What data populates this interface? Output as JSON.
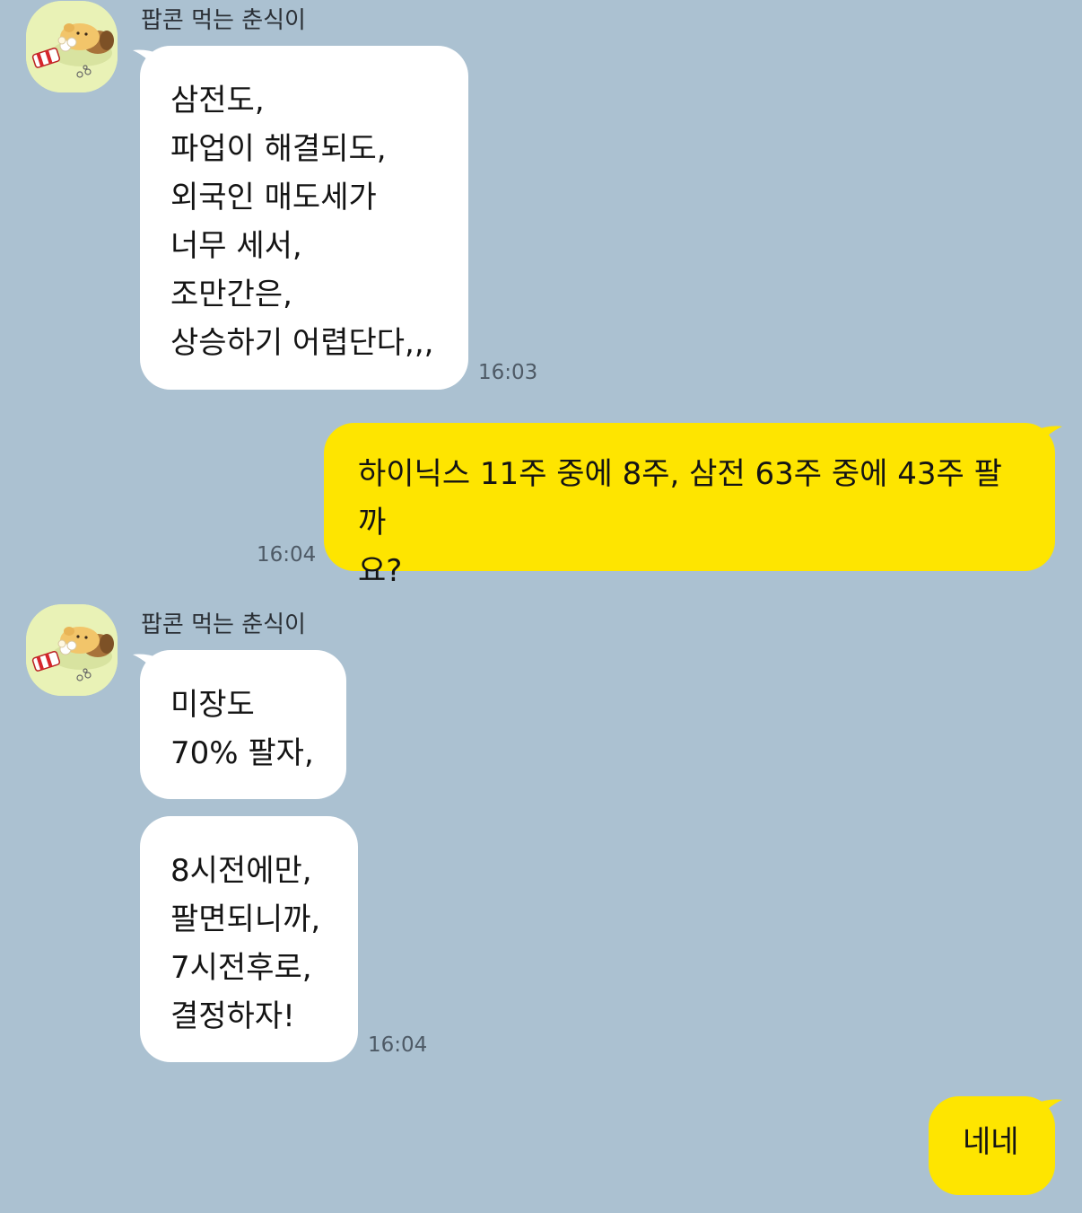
{
  "chat": {
    "colors": {
      "background": "#abc1d1",
      "incoming_bubble": "#ffffff",
      "outgoing_bubble": "#fee500"
    },
    "messages": [
      {
        "sender": "팝콘 먹는 춘식이",
        "text": "삼전도,\n파업이 해결되도,\n외국인 매도세가\n너무 세서,\n조만간은,\n상승하기 어렵단다,,,",
        "time": "16:03"
      },
      {
        "text": "하이닉스 11주 중에 8주, 삼전 63주 중에 43주 팔까\n요?",
        "time": "16:04"
      },
      {
        "sender": "팝콘 먹는 춘식이",
        "text": "미장도\n70% 팔자,"
      },
      {
        "text": "8시전에만,\n팔면되니까,\n7시전후로,\n결정하자!",
        "time": "16:04"
      },
      {
        "text": "네네"
      }
    ]
  }
}
